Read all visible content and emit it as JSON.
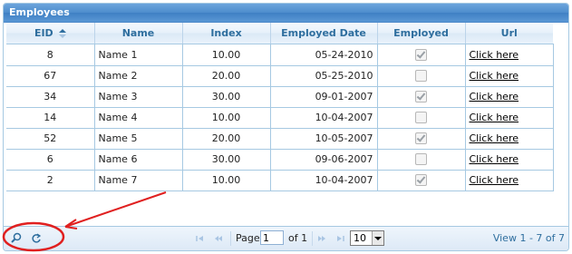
{
  "grid": {
    "caption": "Employees",
    "columns": [
      "EID",
      "Name",
      "Index",
      "Employed Date",
      "Employed",
      "Url"
    ],
    "sorted_column": "EID",
    "rows": [
      {
        "eid": "8",
        "name": "Name 1",
        "index": "10.00",
        "date": "05-24-2010",
        "employed": true,
        "url": "Click here"
      },
      {
        "eid": "67",
        "name": "Name 2",
        "index": "20.00",
        "date": "05-25-2010",
        "employed": false,
        "url": "Click here"
      },
      {
        "eid": "34",
        "name": "Name 3",
        "index": "30.00",
        "date": "09-01-2007",
        "employed": true,
        "url": "Click here"
      },
      {
        "eid": "14",
        "name": "Name 4",
        "index": "10.00",
        "date": "10-04-2007",
        "employed": false,
        "url": "Click here"
      },
      {
        "eid": "52",
        "name": "Name 5",
        "index": "20.00",
        "date": "10-05-2007",
        "employed": true,
        "url": "Click here"
      },
      {
        "eid": "6",
        "name": "Name 6",
        "index": "30.00",
        "date": "09-06-2007",
        "employed": false,
        "url": "Click here"
      },
      {
        "eid": "2",
        "name": "Name 7",
        "index": "10.00",
        "date": "10-04-2007",
        "employed": true,
        "url": "Click here"
      }
    ]
  },
  "pager": {
    "tools": [
      "search-icon",
      "refresh-icon"
    ],
    "page_label": "Page",
    "page_value": "1",
    "of_label": "of 1",
    "rows_per_page": "10",
    "view_info": "View 1 - 7 of 7"
  },
  "annotation": {
    "color": "#e02020",
    "shape": "ellipse-with-arrow"
  }
}
